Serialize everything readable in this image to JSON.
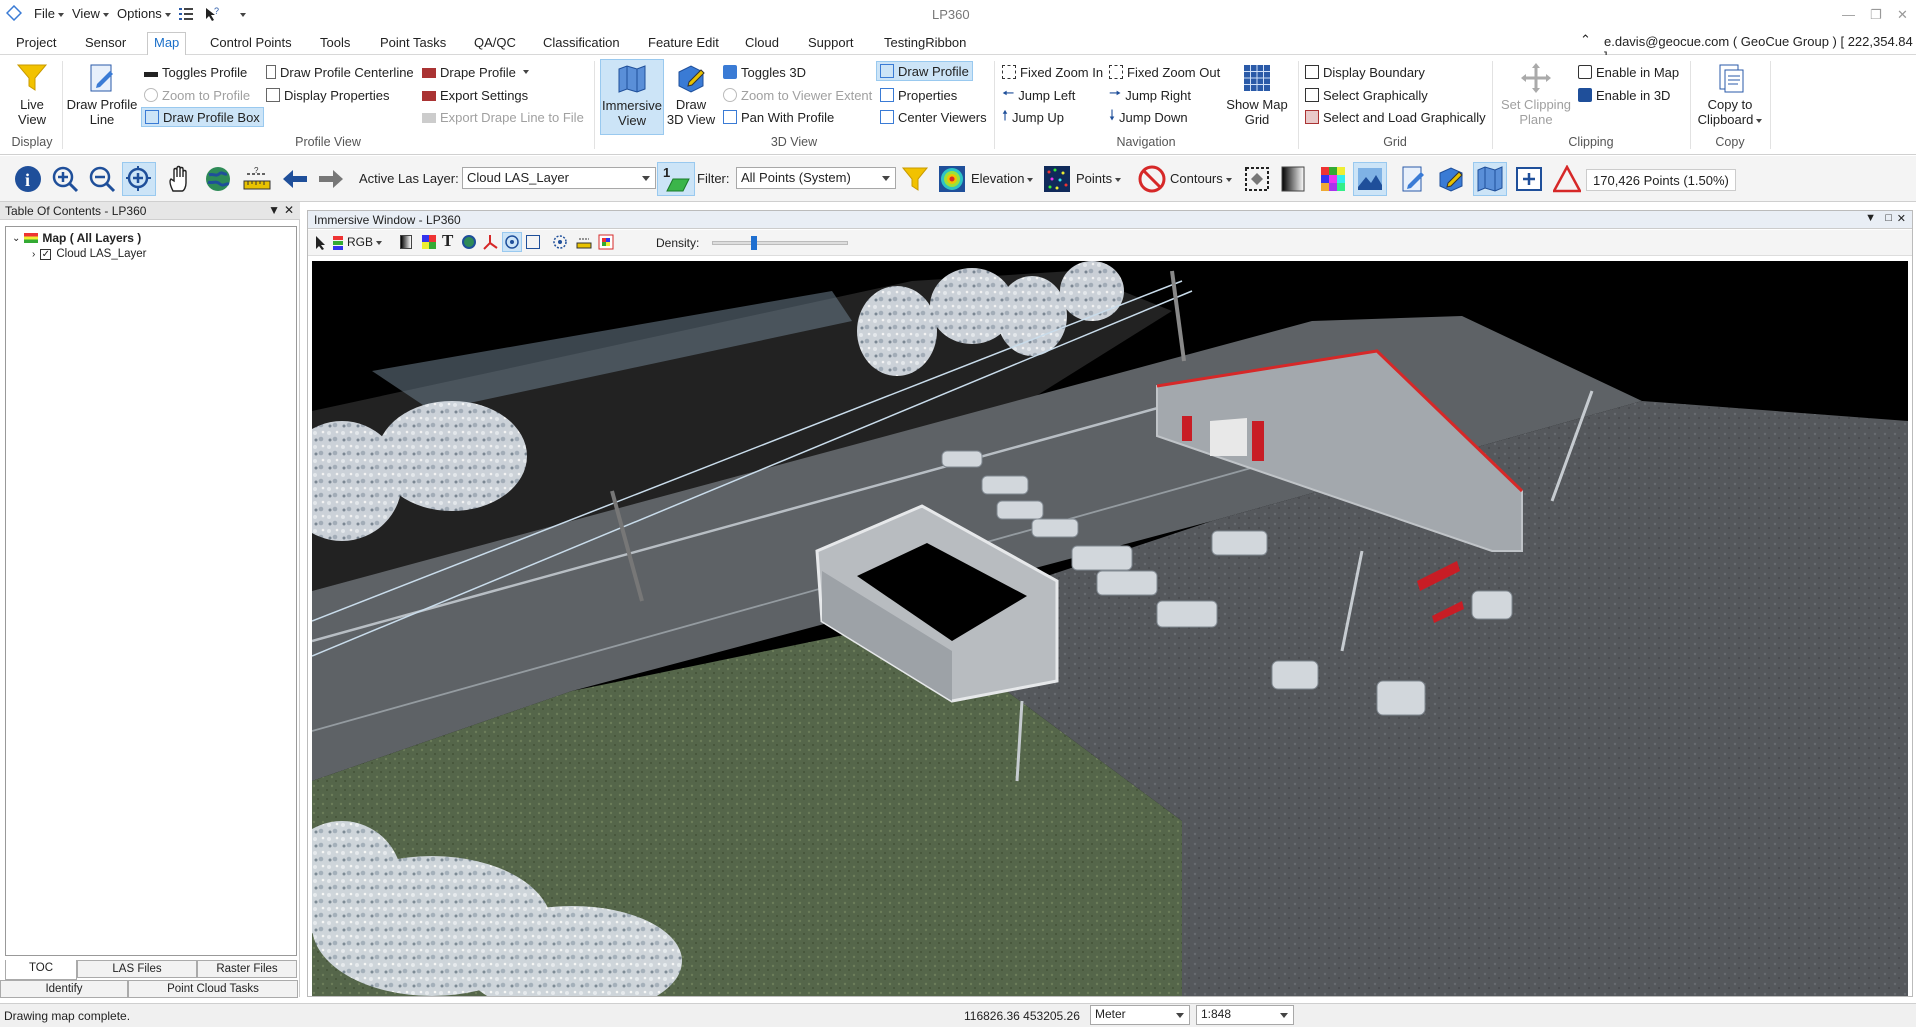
{
  "app": {
    "title": "LP360",
    "menus": [
      "File",
      "View",
      "Options"
    ],
    "user": "e.davis@geocue.com ( GeoCue Group ) [ 222,354.84 ]"
  },
  "tabs": [
    "Project",
    "Sensor",
    "Map",
    "Control Points",
    "Tools",
    "Point Tasks",
    "QA/QC",
    "Classification",
    "Feature Edit",
    "Cloud",
    "Support",
    "TestingRibbon"
  ],
  "active_tab": "Map",
  "ribbon": {
    "display": {
      "label": "Display",
      "live_view": "Live View"
    },
    "profile_view": {
      "label": "Profile View",
      "draw_profile_line": "Draw Profile Line",
      "toggles_profile": "Toggles Profile",
      "zoom_to_profile": "Zoom to Profile",
      "draw_profile_box": "Draw Profile Box",
      "draw_profile_centerline": "Draw Profile Centerline",
      "display_properties": "Display Properties",
      "drape_profile": "Drape Profile",
      "export_settings": "Export Settings",
      "export_drape_line": "Export Drape Line to File"
    },
    "view3d": {
      "label": "3D View",
      "immersive_view": "Immersive View",
      "draw_3d_view": "Draw 3D View",
      "toggles_3d": "Toggles 3D",
      "zoom_to_viewer_extent": "Zoom to Viewer Extent",
      "pan_with_profile": "Pan With Profile",
      "draw_profile": "Draw Profile",
      "properties": "Properties",
      "center_viewers": "Center Viewers"
    },
    "navigation": {
      "label": "Navigation",
      "fixed_zoom_in": "Fixed Zoom In",
      "fixed_zoom_out": "Fixed Zoom Out",
      "jump_left": "Jump Left",
      "jump_right": "Jump Right",
      "jump_up": "Jump Up",
      "jump_down": "Jump Down",
      "show_map_grid": "Show Map Grid"
    },
    "grid": {
      "label": "Grid",
      "display_boundary": "Display Boundary",
      "select_graphically": "Select Graphically",
      "select_and_load": "Select and Load Graphically"
    },
    "clipping": {
      "label": "Clipping",
      "set_clipping_plane": "Set Clipping Plane",
      "enable_in_map": "Enable in Map",
      "enable_in_3d": "Enable in 3D"
    },
    "copy": {
      "label": "Copy",
      "copy_to_clipboard": "Copy to Clipboard"
    }
  },
  "toolbar": {
    "active_las_label": "Active Las Layer:",
    "active_las_value": "Cloud LAS_Layer",
    "filter_label": "Filter:",
    "filter_value": "All Points (System)",
    "elevation": "Elevation",
    "points": "Points",
    "contours": "Contours",
    "point_count": "170,426 Points (1.50%)"
  },
  "toc": {
    "title": "Table Of Contents - LP360",
    "root": "Map ( All Layers )",
    "layer": "Cloud LAS_Layer",
    "tabs": [
      "TOC",
      "LAS Files",
      "Raster Files"
    ],
    "bottom_tabs": [
      "Identify",
      "Point Cloud Tasks"
    ]
  },
  "immersive": {
    "title": "Immersive Window - LP360",
    "rgb": "RGB",
    "density": "Density:",
    "density_level": 0.3
  },
  "status": {
    "message": "Drawing map complete.",
    "coords": "116826.36 453205.26",
    "units": "Meter",
    "scale": "1:848"
  }
}
